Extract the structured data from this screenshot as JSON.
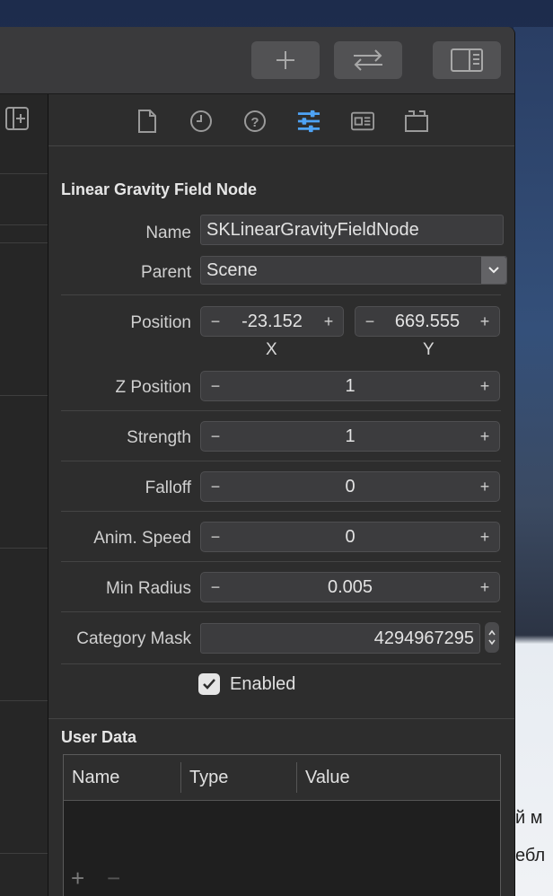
{
  "toolbar": {
    "add_icon": "plus-icon",
    "swap_icon": "swap-arrows-icon",
    "panel_icon": "right-panel-icon"
  },
  "inspector_tabs": [
    "file-icon",
    "history-clock-icon",
    "help-question-icon",
    "attributes-sliders-icon",
    "size-ruler-icon",
    "library-box-icon"
  ],
  "node": {
    "section_title": "Linear Gravity Field Node",
    "name_label": "Name",
    "name_value": "SKLinearGravityFieldNode",
    "parent_label": "Parent",
    "parent_value": "Scene",
    "position_label": "Position",
    "position_x": "-23.152",
    "position_y": "669.555",
    "x_label": "X",
    "y_label": "Y",
    "zposition_label": "Z Position",
    "zposition_value": "1",
    "strength_label": "Strength",
    "strength_value": "1",
    "falloff_label": "Falloff",
    "falloff_value": "0",
    "animspeed_label": "Anim. Speed",
    "animspeed_value": "0",
    "minradius_label": "Min Radius",
    "minradius_value": "0.005",
    "categorymask_label": "Category Mask",
    "categorymask_value": "4294967295",
    "enabled_label": "Enabled",
    "enabled": true,
    "minus": "−",
    "plus": "+"
  },
  "user_data": {
    "section_title": "User Data",
    "columns": [
      "Name",
      "Type",
      "Value"
    ],
    "add": "+",
    "remove": "−"
  },
  "background_text": [
    "й м",
    "ебл"
  ]
}
